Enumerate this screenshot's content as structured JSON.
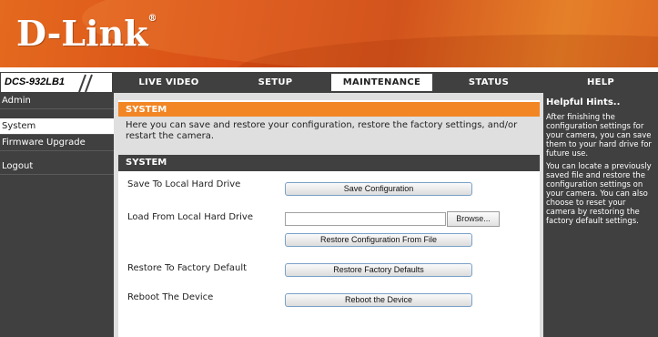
{
  "brand": {
    "logo_text": "D-Link",
    "logo_mark": "®",
    "model": "DCS-932LB1"
  },
  "nav": {
    "tabs": [
      {
        "label": "LIVE VIDEO"
      },
      {
        "label": "SETUP"
      },
      {
        "label": "MAINTENANCE",
        "active": true
      },
      {
        "label": "STATUS"
      },
      {
        "label": "HELP"
      }
    ]
  },
  "sidebar": {
    "items": [
      {
        "label": "Admin"
      },
      {
        "label": "System",
        "active": true
      },
      {
        "label": "Firmware Upgrade"
      },
      {
        "label": "Logout"
      }
    ]
  },
  "main": {
    "intro": {
      "title": "SYSTEM",
      "description": "Here you can save and restore your configuration, restore the factory settings, and/or restart the camera."
    },
    "system": {
      "title": "SYSTEM",
      "save_label": "Save To Local Hard Drive",
      "save_button": "Save Configuration",
      "load_label": "Load From Local Hard Drive",
      "file_value": "",
      "browse_button": "Browse...",
      "restore_file_button": "Restore Configuration From File",
      "factory_label": "Restore To Factory Default",
      "factory_button": "Restore Factory Defaults",
      "reboot_label": "Reboot The Device",
      "reboot_button": "Reboot the Device"
    }
  },
  "help": {
    "title": "Helpful Hints..",
    "paragraphs": [
      "After finishing the configuration settings for your camera, you can save them to your hard drive for future use.",
      "You can locate a previously saved file and restore the configuration settings on your camera. You can also choose to reset your camera by restoring the factory default settings."
    ]
  },
  "colors": {
    "accent_orange": "#f28624",
    "dark_gray": "#404040",
    "panel_gray": "#dfdfdf",
    "button_border": "#7aa0c8"
  }
}
